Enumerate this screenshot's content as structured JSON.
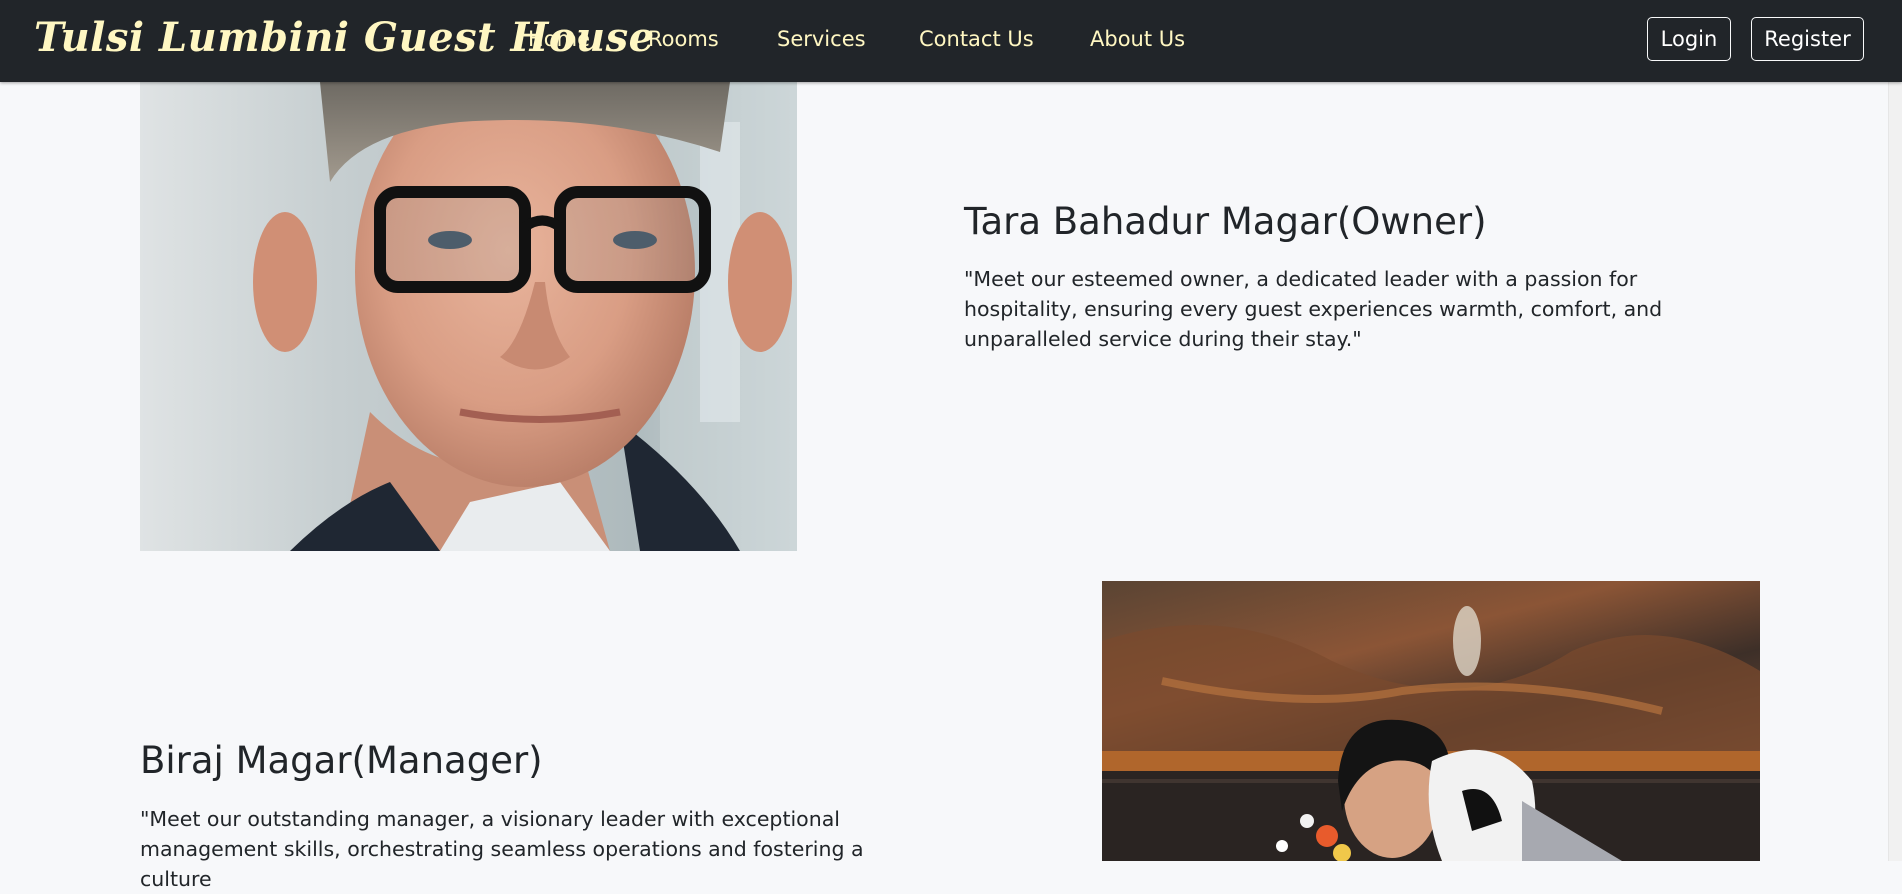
{
  "navbar": {
    "brand": "Tulsi Lumbini Guest House",
    "links": [
      "Home",
      "Rooms",
      "Services",
      "Contact Us",
      "About Us"
    ],
    "login_label": "Login",
    "register_label": "Register",
    "text_color": "#fff7c2",
    "background": "#212529"
  },
  "team": [
    {
      "name": "Tara Bahadur Magar(Owner)",
      "bio": "\"Meet our esteemed owner, a dedicated leader with a passion for hospitality, ensuring every guest experiences warmth, comfort, and unparalleled service during their stay.\""
    },
    {
      "name": "Biraj Magar(Manager)",
      "bio": "\"Meet our outstanding manager, a visionary leader with exceptional management skills, orchestrating seamless operations and fostering a culture"
    }
  ]
}
